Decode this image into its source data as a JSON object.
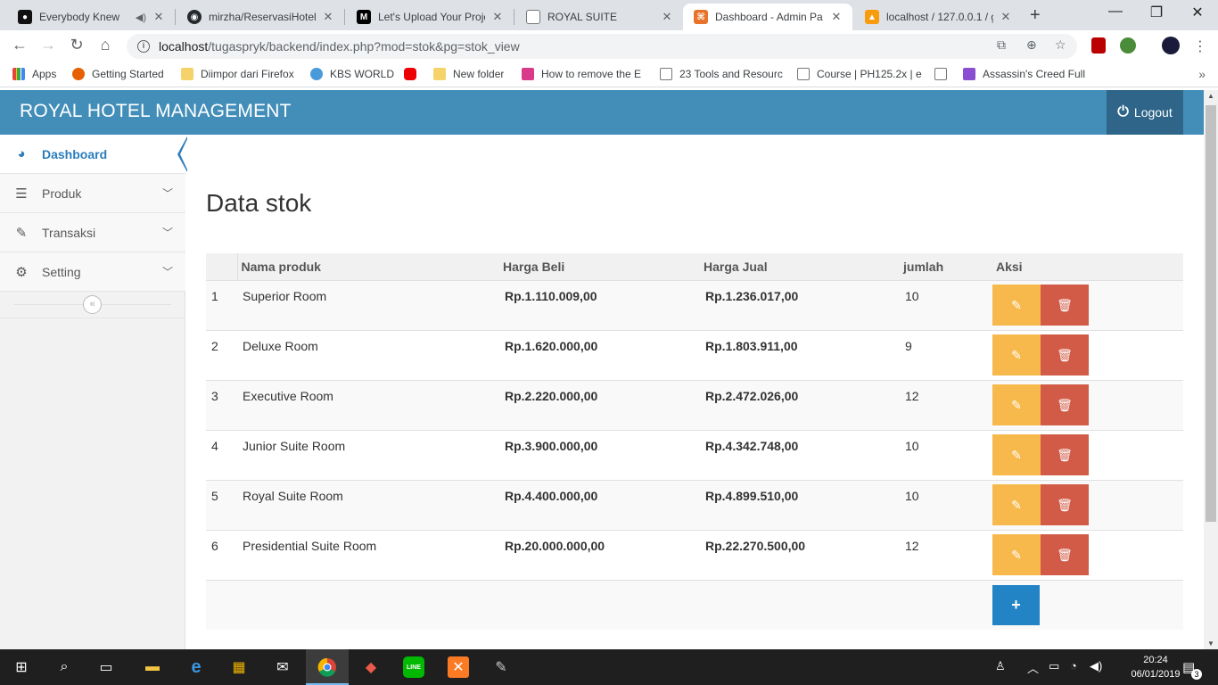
{
  "browser": {
    "tabs": [
      {
        "title": "Everybody Knew",
        "active": false
      },
      {
        "title": "mirzha/ReservasiHotel",
        "active": false
      },
      {
        "title": "Let's Upload Your Proje",
        "active": false
      },
      {
        "title": "ROYAL SUITE",
        "active": false
      },
      {
        "title": "Dashboard - Admin Pa",
        "active": true
      },
      {
        "title": "localhost / 127.0.0.1 / g",
        "active": false
      }
    ],
    "url_host": "localhost",
    "url_path": "/tugaspryk/backend/index.php?mod=stok&pg=stok_view",
    "bookmarks": [
      {
        "label": "Apps"
      },
      {
        "label": "Getting Started"
      },
      {
        "label": "Diimpor dari Firefox"
      },
      {
        "label": "KBS WORLD"
      },
      {
        "label": ""
      },
      {
        "label": "New folder"
      },
      {
        "label": "How to remove the E"
      },
      {
        "label": "23 Tools and Resourc"
      },
      {
        "label": "Course | PH125.2x | e"
      },
      {
        "label": ""
      },
      {
        "label": "Assassin's Creed Full"
      }
    ]
  },
  "header": {
    "brand": "ROYAL HOTEL MANAGEMENT",
    "logout_label": "Logout"
  },
  "sidebar": {
    "items": [
      {
        "label": "Dashboard",
        "icon": "dashboard-icon"
      },
      {
        "label": "Produk",
        "icon": "list-icon"
      },
      {
        "label": "Transaksi",
        "icon": "pencil-icon"
      },
      {
        "label": "Setting",
        "icon": "gear-icon"
      }
    ],
    "collapse_glyph": "«"
  },
  "main": {
    "title": "Data stok",
    "columns": [
      "",
      "Nama produk",
      "Harga Beli",
      "Harga Jual",
      "jumlah",
      "Aksi"
    ],
    "rows": [
      {
        "no": "1",
        "nama": "Superior Room",
        "beli": "Rp.1.110.009,00",
        "jual": "Rp.1.236.017,00",
        "jumlah": "10"
      },
      {
        "no": "2",
        "nama": "Deluxe Room",
        "beli": "Rp.1.620.000,00",
        "jual": "Rp.1.803.911,00",
        "jumlah": "9"
      },
      {
        "no": "3",
        "nama": "Executive Room",
        "beli": "Rp.2.220.000,00",
        "jual": "Rp.2.472.026,00",
        "jumlah": "12"
      },
      {
        "no": "4",
        "nama": "Junior Suite Room",
        "beli": "Rp.3.900.000,00",
        "jual": "Rp.4.342.748,00",
        "jumlah": "10"
      },
      {
        "no": "5",
        "nama": "Royal Suite Room",
        "beli": "Rp.4.400.000,00",
        "jual": "Rp.4.899.510,00",
        "jumlah": "10"
      },
      {
        "no": "6",
        "nama": "Presidential Suite Room",
        "beli": "Rp.20.000.000,00",
        "jual": "Rp.22.270.500,00",
        "jumlah": "12"
      }
    ]
  },
  "taskbar": {
    "time": "20:24",
    "date": "06/01/2019",
    "notifications": "3"
  },
  "colors": {
    "navbar": "#438eb9",
    "logout_bg": "#2e6589",
    "edit": "#f7b94c",
    "delete": "#d15b47",
    "add": "#2283c5",
    "active_link": "#2b7dbc"
  }
}
